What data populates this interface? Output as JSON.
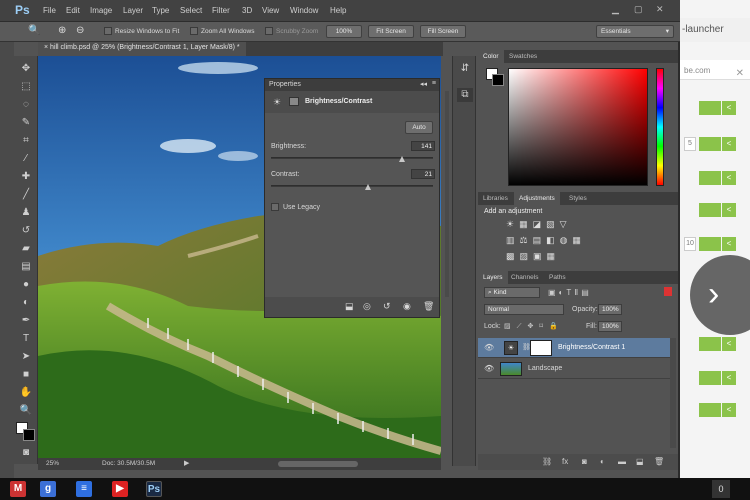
{
  "app": {
    "logo": "Ps"
  },
  "menu": [
    "File",
    "Edit",
    "Image",
    "Layer",
    "Type",
    "Select",
    "Filter",
    "3D",
    "View",
    "Window",
    "Help"
  ],
  "options_bar": {
    "resize_windows": "Resize Windows to Fit",
    "zoom_all": "Zoom All Windows",
    "scrubby": "Scrubby Zoom",
    "zoom_pct": "100%",
    "fit_screen": "Fit Screen",
    "fill_screen": "Fill Screen",
    "workspace": "Essentials"
  },
  "document_tab": "hill climb.psd @ 25% (Brightness/Contrast 1, Layer Mask/8) *",
  "status": {
    "zoom": "25%",
    "doc": "Doc: 30.5M/30.5M"
  },
  "properties": {
    "header": "Properties",
    "title": "Brightness/Contrast",
    "auto": "Auto",
    "brightness_label": "Brightness:",
    "brightness_value": "141",
    "brightness_level": 0.81,
    "contrast_label": "Contrast:",
    "contrast_value": "21",
    "contrast_level": 0.6,
    "legacy": "Use Legacy"
  },
  "color_panel": {
    "tabs": [
      "Color",
      "Swatches"
    ]
  },
  "adjust_panel": {
    "tabs": [
      "Libraries",
      "Adjustments",
      "Styles"
    ],
    "heading": "Add an adjustment"
  },
  "layers_panel": {
    "tabs": [
      "Layers",
      "Channels",
      "Paths"
    ],
    "kind": "Kind",
    "blend": "Normal",
    "opacity_label": "Opacity:",
    "opacity": "100%",
    "lock_label": "Lock:",
    "fill_label": "Fill:",
    "fill": "100%",
    "layers": [
      {
        "name": "Brightness/Contrast 1",
        "selected": true
      },
      {
        "name": "Landscape",
        "selected": false
      }
    ]
  },
  "browser": {
    "tab_text": "-launcher",
    "url_text": "be.com",
    "row_numbers": [
      "5",
      "10"
    ]
  },
  "taskbar": {
    "clock": "0"
  },
  "colors": {
    "ps_bg": "#535353",
    "accent": "#9ccef6",
    "selected_layer": "#5d7b9e",
    "green_button": "#8bc34a"
  }
}
